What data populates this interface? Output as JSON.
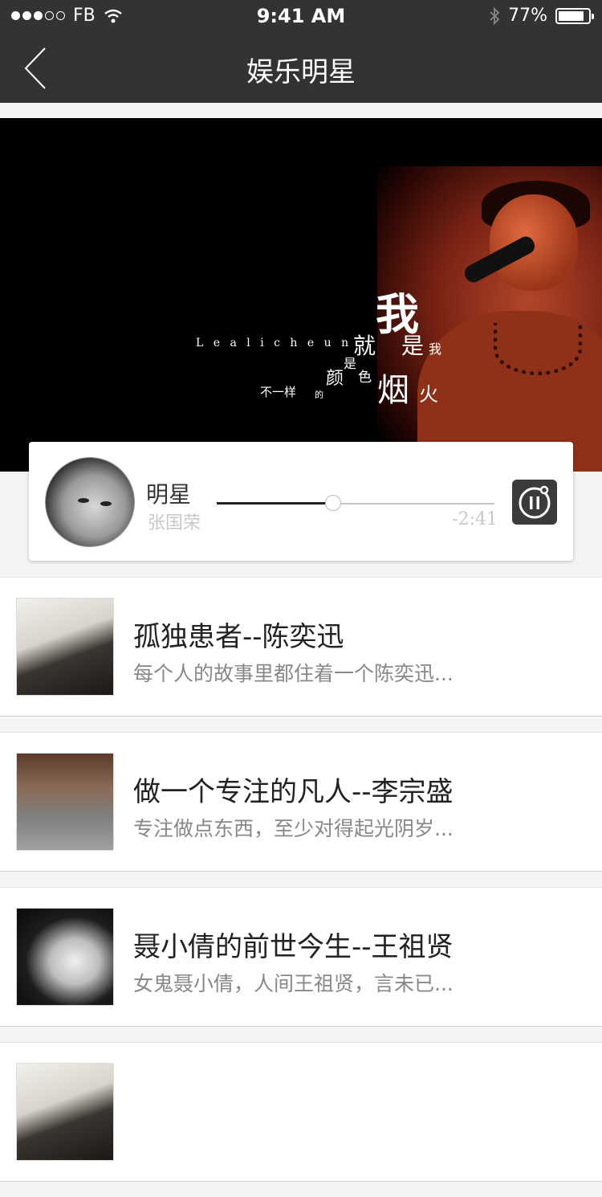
{
  "status_bar": {
    "carrier": "FB",
    "time": "9:41 AM",
    "battery": "77%",
    "battery_level": 0.77,
    "signal_dots_filled": 3,
    "signal_dots_total": 5
  },
  "nav": {
    "title": "娱乐明星",
    "back_icon": "chevron-left-icon"
  },
  "banner": {
    "lyric_wo": "我",
    "lyric_jiu": "就",
    "lyric_shi": "是",
    "lyric_wo_small": "我",
    "lyric_latin": "L e  a l i c h e u n",
    "lyric_shi_small": "是",
    "lyric_yan": "颜",
    "lyric_se": "色",
    "lyric_yan2": "烟",
    "lyric_huo": "火",
    "lyric_buyiyang": "不一样",
    "lyric_de": "的"
  },
  "player": {
    "title": "明星",
    "artist": "张国荣",
    "remaining": "-2:41",
    "progress": 0.42,
    "pause_icon": "pause-icon"
  },
  "articles": [
    {
      "title": "孤独患者--陈奕迅",
      "desc": "每个人的故事里都住着一个陈奕迅..."
    },
    {
      "title": "做一个专注的凡人--李宗盛",
      "desc": "专注做点东西，至少对得起光阴岁..."
    },
    {
      "title": "聂小倩的前世今生--王祖贤",
      "desc": "女鬼聂小倩，人间王祖贤，言未已..."
    }
  ]
}
